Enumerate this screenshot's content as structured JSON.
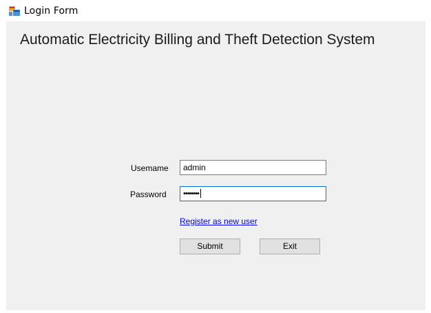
{
  "window": {
    "title": "Login Form",
    "icon": "winforms-app-icon"
  },
  "form": {
    "heading": "Automatic Electricity Billing and Theft Detection System",
    "username_label": "Usemame",
    "username_value": "admin",
    "password_label": "Password",
    "password_value": "••••••••",
    "register_link": "Register as new user",
    "submit_label": "Submit",
    "exit_label": "Exit"
  },
  "colors": {
    "client_background": "#f0f0f0",
    "focus_border": "#0078d7",
    "link": "#0000ff",
    "button_face": "#e1e1e1"
  }
}
